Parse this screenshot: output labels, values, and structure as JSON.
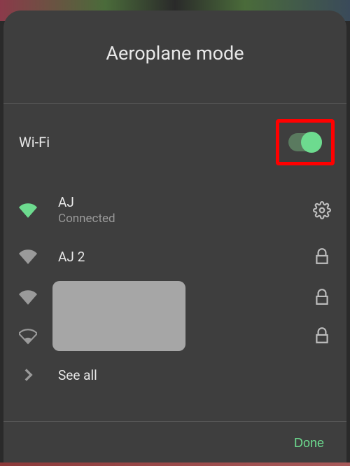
{
  "title": "Aeroplane mode",
  "wifi": {
    "section_label": "Wi-Fi",
    "toggle_on": true
  },
  "networks": [
    {
      "name": "AJ",
      "status": "Connected",
      "signal": "full",
      "connected": true,
      "secured": false
    },
    {
      "name": "AJ 2",
      "status": "",
      "signal": "full",
      "connected": false,
      "secured": true
    },
    {
      "name": "",
      "status": "",
      "signal": "full",
      "connected": false,
      "secured": true,
      "redacted": true
    },
    {
      "name": "",
      "status": "",
      "signal": "weak",
      "connected": false,
      "secured": true,
      "redacted": true
    }
  ],
  "see_all_label": "See all",
  "done_label": "Done"
}
